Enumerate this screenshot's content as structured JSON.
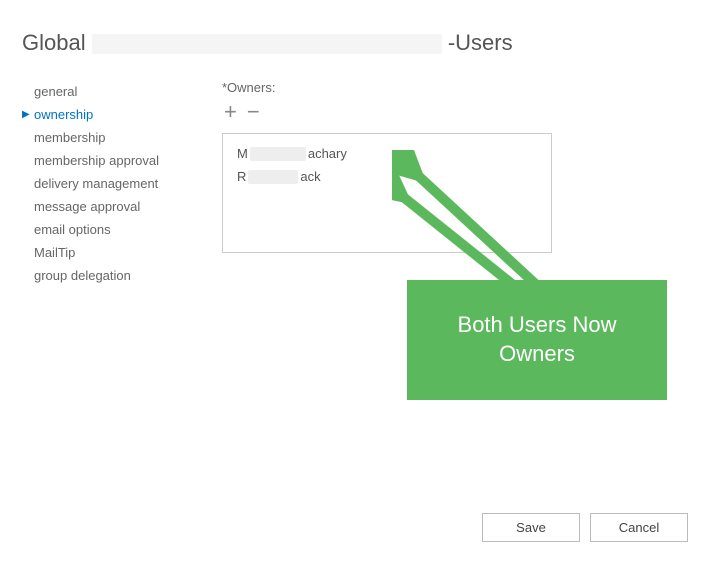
{
  "header": {
    "title_prefix": "Global",
    "title_suffix": "-Users"
  },
  "sidebar": {
    "items": [
      {
        "label": "general",
        "active": false
      },
      {
        "label": "ownership",
        "active": true
      },
      {
        "label": "membership",
        "active": false
      },
      {
        "label": "membership approval",
        "active": false
      },
      {
        "label": "delivery management",
        "active": false
      },
      {
        "label": "message approval",
        "active": false
      },
      {
        "label": "email options",
        "active": false
      },
      {
        "label": "MailTip",
        "active": false
      },
      {
        "label": "group delegation",
        "active": false
      }
    ]
  },
  "owners": {
    "label": "*Owners:",
    "list": [
      {
        "prefix": "M",
        "redact_width": 56,
        "suffix": "achary"
      },
      {
        "prefix": "R",
        "redact_width": 50,
        "suffix": "ack"
      }
    ]
  },
  "callout": {
    "text": "Both Users Now Owners",
    "bg_color": "#5cb85c"
  },
  "footer": {
    "save_label": "Save",
    "cancel_label": "Cancel"
  }
}
